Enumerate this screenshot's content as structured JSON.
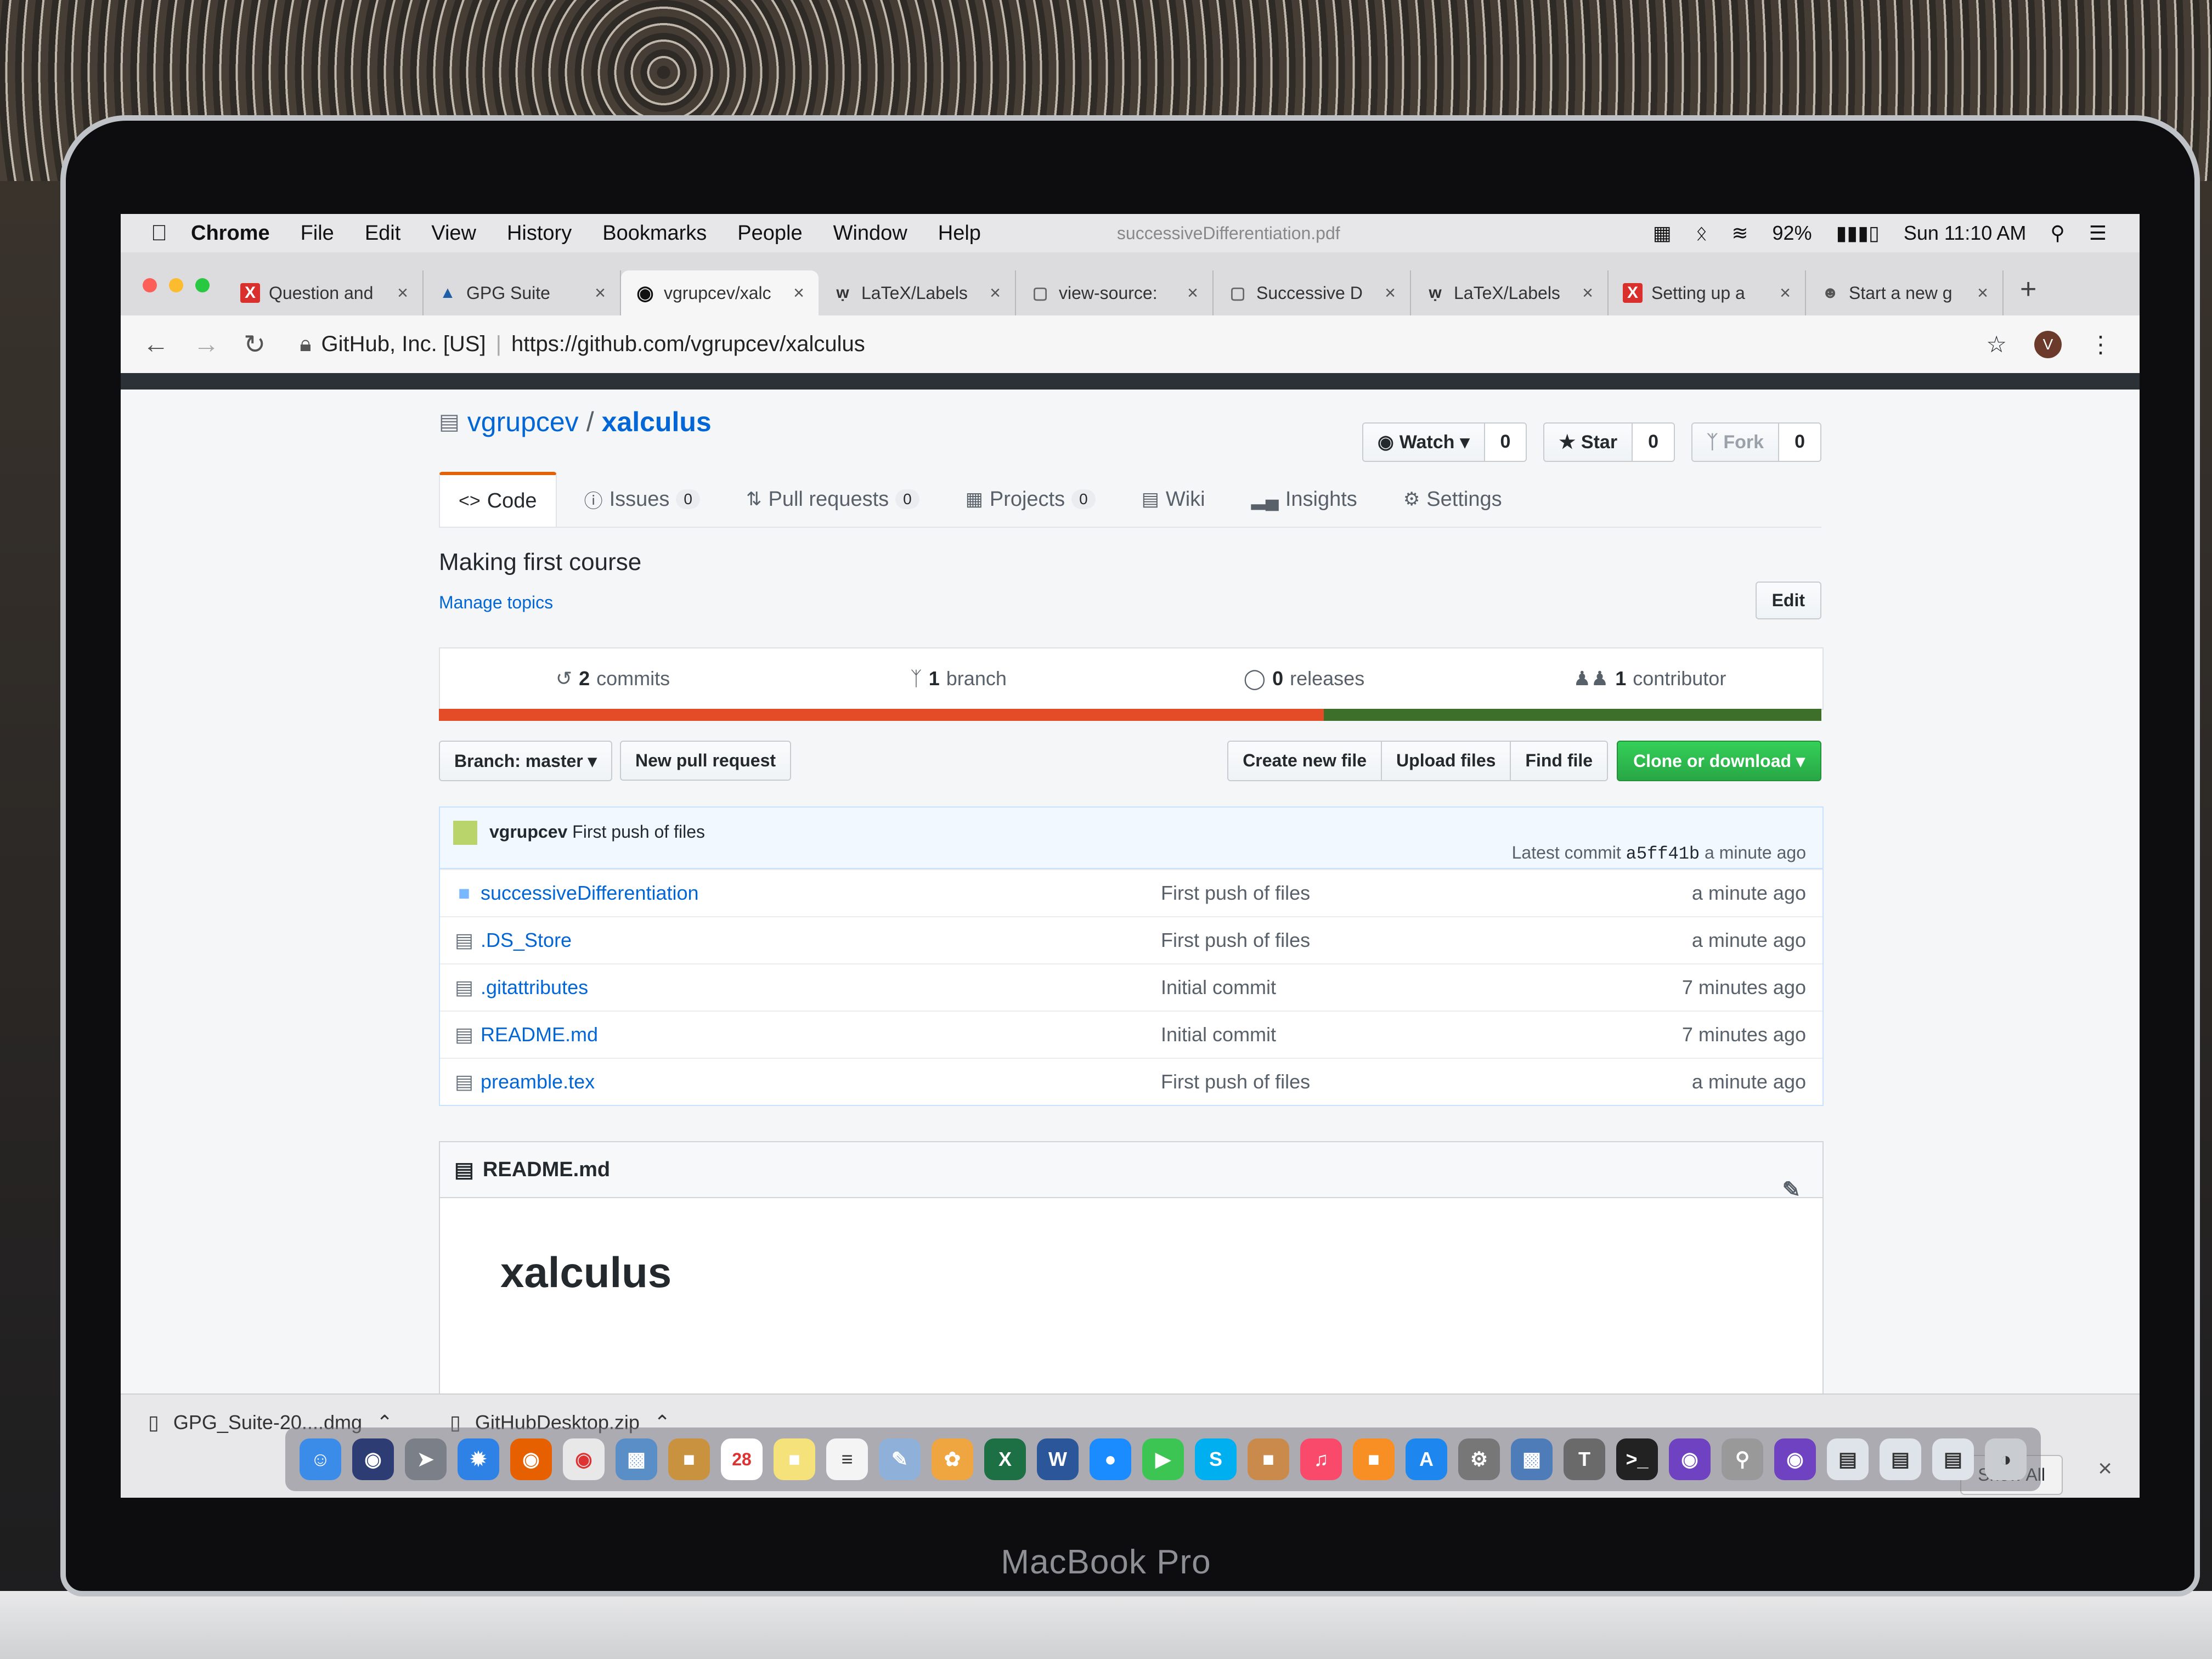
{
  "menubar": {
    "app": "Chrome",
    "items": [
      "File",
      "Edit",
      "View",
      "History",
      "Bookmarks",
      "People",
      "Window",
      "Help"
    ],
    "battery": "92%",
    "clock": "Sun 11:10 AM"
  },
  "popup_title": "successiveDifferentiation.pdf",
  "tabs": [
    {
      "label": "Question and",
      "icon": "x-icon"
    },
    {
      "label": "GPG Suite",
      "icon": "gpg-icon"
    },
    {
      "label": "vgrupcev/xalc",
      "icon": "github-icon"
    },
    {
      "label": "LaTeX/Labels",
      "icon": "wikibooks-icon"
    },
    {
      "label": "view-source:",
      "icon": "page-icon"
    },
    {
      "label": "Successive D",
      "icon": "page-icon"
    },
    {
      "label": "LaTeX/Labels",
      "icon": "wikibooks-icon"
    },
    {
      "label": "Setting up a",
      "icon": "x-icon"
    },
    {
      "label": "Start a new g",
      "icon": "avatar-icon"
    }
  ],
  "address": {
    "org": "GitHub, Inc. [US]",
    "url": "https://github.com/vgrupcev/xalculus"
  },
  "profile_initial": "V",
  "repo": {
    "owner": "vgrupcev",
    "name": "xalculus",
    "watch_label": "Watch",
    "watch_count": "0",
    "star_label": "Star",
    "star_count": "0",
    "fork_label": "Fork",
    "fork_count": "0",
    "nav": [
      {
        "label": "Code",
        "count": ""
      },
      {
        "label": "Issues",
        "count": "0"
      },
      {
        "label": "Pull requests",
        "count": "0"
      },
      {
        "label": "Projects",
        "count": "0"
      },
      {
        "label": "Wiki",
        "count": ""
      },
      {
        "label": "Insights",
        "count": ""
      },
      {
        "label": "Settings",
        "count": ""
      }
    ],
    "description": "Making first course",
    "manage_topics": "Manage topics",
    "edit": "Edit",
    "summary": {
      "commits_n": "2",
      "commits_l": "commits",
      "branch_n": "1",
      "branch_l": "branch",
      "releases_n": "0",
      "releases_l": "releases",
      "contrib_n": "1",
      "contrib_l": "contributor"
    },
    "lang_colors": [
      "#e34c26",
      "#e34c26",
      "#3d6e2a"
    ],
    "branch_btn": "Branch: master",
    "new_pr": "New pull request",
    "create_file": "Create new file",
    "upload_files": "Upload files",
    "find_file": "Find file",
    "clone": "Clone or download",
    "commit": {
      "author": "vgrupcev",
      "message": "First push of files",
      "latest_label": "Latest commit",
      "sha": "a5ff41b",
      "age": "a minute ago"
    },
    "files": [
      {
        "name": "successiveDifferentiation",
        "type": "dir",
        "message": "First push of files",
        "age": "a minute ago"
      },
      {
        "name": ".DS_Store",
        "type": "file",
        "message": "First push of files",
        "age": "a minute ago"
      },
      {
        "name": ".gitattributes",
        "type": "file",
        "message": "Initial commit",
        "age": "7 minutes ago"
      },
      {
        "name": "README.md",
        "type": "file",
        "message": "Initial commit",
        "age": "7 minutes ago"
      },
      {
        "name": "preamble.tex",
        "type": "file",
        "message": "First push of files",
        "age": "a minute ago"
      }
    ],
    "readme_title": "README.md",
    "readme_heading": "xalculus"
  },
  "downloads": {
    "item1": "GPG_Suite-20....dmg",
    "item2": "GitHubDesktop.zip",
    "show_all": "Show All"
  },
  "dock": {
    "calendar_day": "28"
  },
  "bezel_label": "MacBook Pro"
}
